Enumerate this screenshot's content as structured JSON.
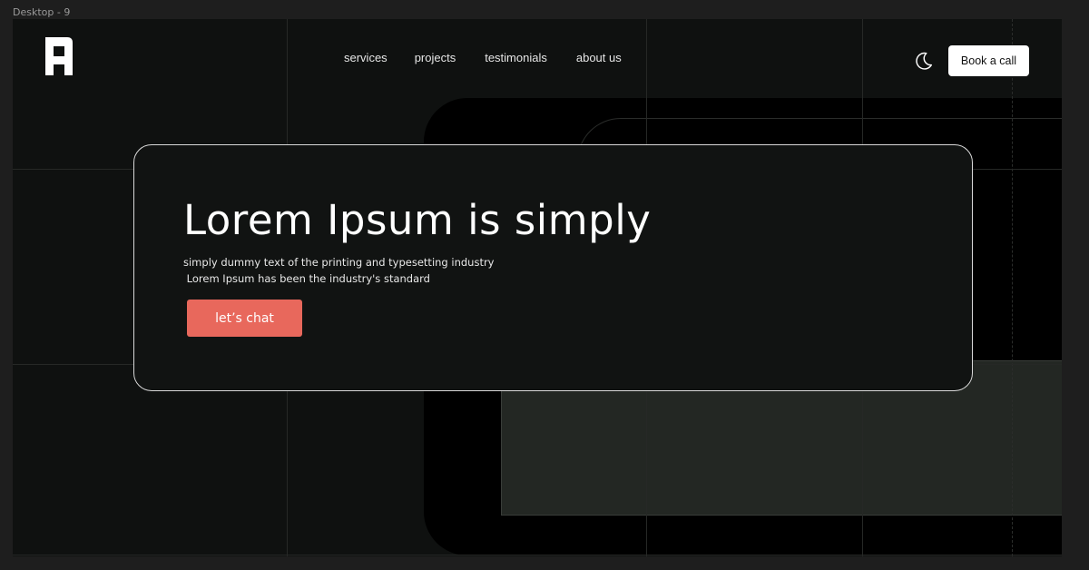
{
  "frame": {
    "label": "Desktop - 9"
  },
  "header": {
    "nav": [
      "services",
      "projects",
      "testimonials",
      "about us"
    ],
    "book_label": "Book a call"
  },
  "hero": {
    "title": "Lorem Ipsum is simply",
    "subtitle": "simply dummy text of the printing and typesetting industry\n Lorem Ipsum has been the industry's standard",
    "cta_label": "let’s chat"
  },
  "colors": {
    "canvas": "#1e1e1e",
    "frame_bg": "#0f1110",
    "cta": "#e8685c",
    "accent_panel": "#232723"
  },
  "icons": {
    "logo": "brand-logo-icon",
    "theme": "moon-icon"
  }
}
